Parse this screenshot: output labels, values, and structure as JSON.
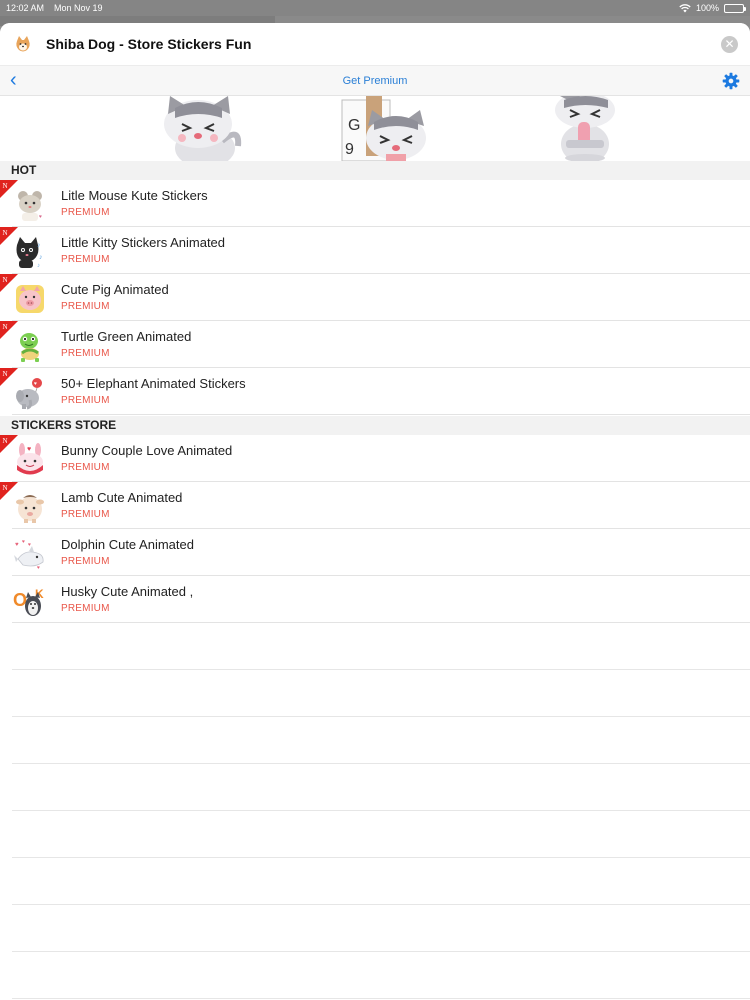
{
  "status_bar": {
    "time": "12:02 AM",
    "date": "Mon Nov 19",
    "battery": "100%"
  },
  "header": {
    "title": "Shiba Dog - Store Stickers Fun",
    "close_symbol": "✕"
  },
  "navbar": {
    "back_symbol": "‹",
    "title": "Get Premium"
  },
  "sections": [
    {
      "title": "HOT"
    },
    {
      "title": "STICKERS STORE"
    }
  ],
  "hot_items": [
    {
      "name": "Litle Mouse Kute Stickers",
      "tag": "PREMIUM",
      "is_new": true,
      "icon": "mouse-sticker-icon"
    },
    {
      "name": "Little Kitty Stickers Animated",
      "tag": "PREMIUM",
      "is_new": true,
      "icon": "kitty-sticker-icon"
    },
    {
      "name": "Cute Pig Animated",
      "tag": "PREMIUM",
      "is_new": true,
      "icon": "pig-sticker-icon"
    },
    {
      "name": "Turtle Green Animated",
      "tag": "PREMIUM",
      "is_new": true,
      "icon": "turtle-sticker-icon"
    },
    {
      "name": "50+ Elephant Animated Stickers",
      "tag": "PREMIUM",
      "is_new": true,
      "icon": "elephant-sticker-icon"
    }
  ],
  "store_items": [
    {
      "name": "Bunny Couple Love Animated",
      "tag": "PREMIUM",
      "is_new": true,
      "icon": "bunny-sticker-icon"
    },
    {
      "name": "Lamb Cute Animated",
      "tag": "PREMIUM",
      "is_new": true,
      "icon": "lamb-sticker-icon"
    },
    {
      "name": "Dolphin Cute Animated",
      "tag": "PREMIUM",
      "is_new": false,
      "icon": "dolphin-sticker-icon"
    },
    {
      "name": "Husky Cute Animated ,",
      "tag": "PREMIUM",
      "is_new": false,
      "icon": "husky-sticker-icon"
    }
  ],
  "new_badge_letter": "N",
  "colors": {
    "accent": "#1d7ae0",
    "premium": "#e9574a",
    "badge": "#e0231e"
  }
}
